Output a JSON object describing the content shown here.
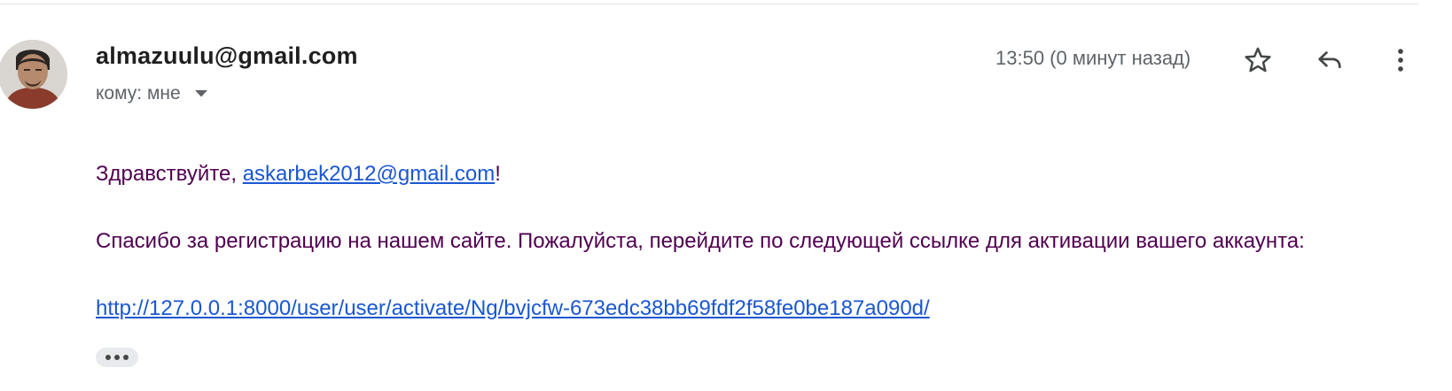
{
  "header": {
    "sender_email": "almazuulu@gmail.com",
    "recipient_label": "кому: мне",
    "timestamp": "13:50 (0 минут назад)"
  },
  "icons": {
    "star": "star-icon",
    "reply": "reply-icon",
    "more": "more-vert-icon",
    "recipient_caret": "chevron-down-icon",
    "trimmed": "more-horiz-icon"
  },
  "body": {
    "greeting_prefix": "Здравствуйте, ",
    "greeting_email": "askarbek2012@gmail.com",
    "greeting_suffix": "!",
    "message": "Спасибо за регистрацию на нашем сайте. Пожалуйста, перейдите по следующей ссылке для активации вашего аккаунта:",
    "activation_link": "http://127.0.0.1:8000/user/user/activate/Ng/bvjcfw-673edc38bb69fdf2f58fe0be187a090d/"
  },
  "colors": {
    "body_text": "#500050",
    "link": "#1a57d2",
    "sender": "#1f1f1f",
    "muted": "#5f6368"
  }
}
